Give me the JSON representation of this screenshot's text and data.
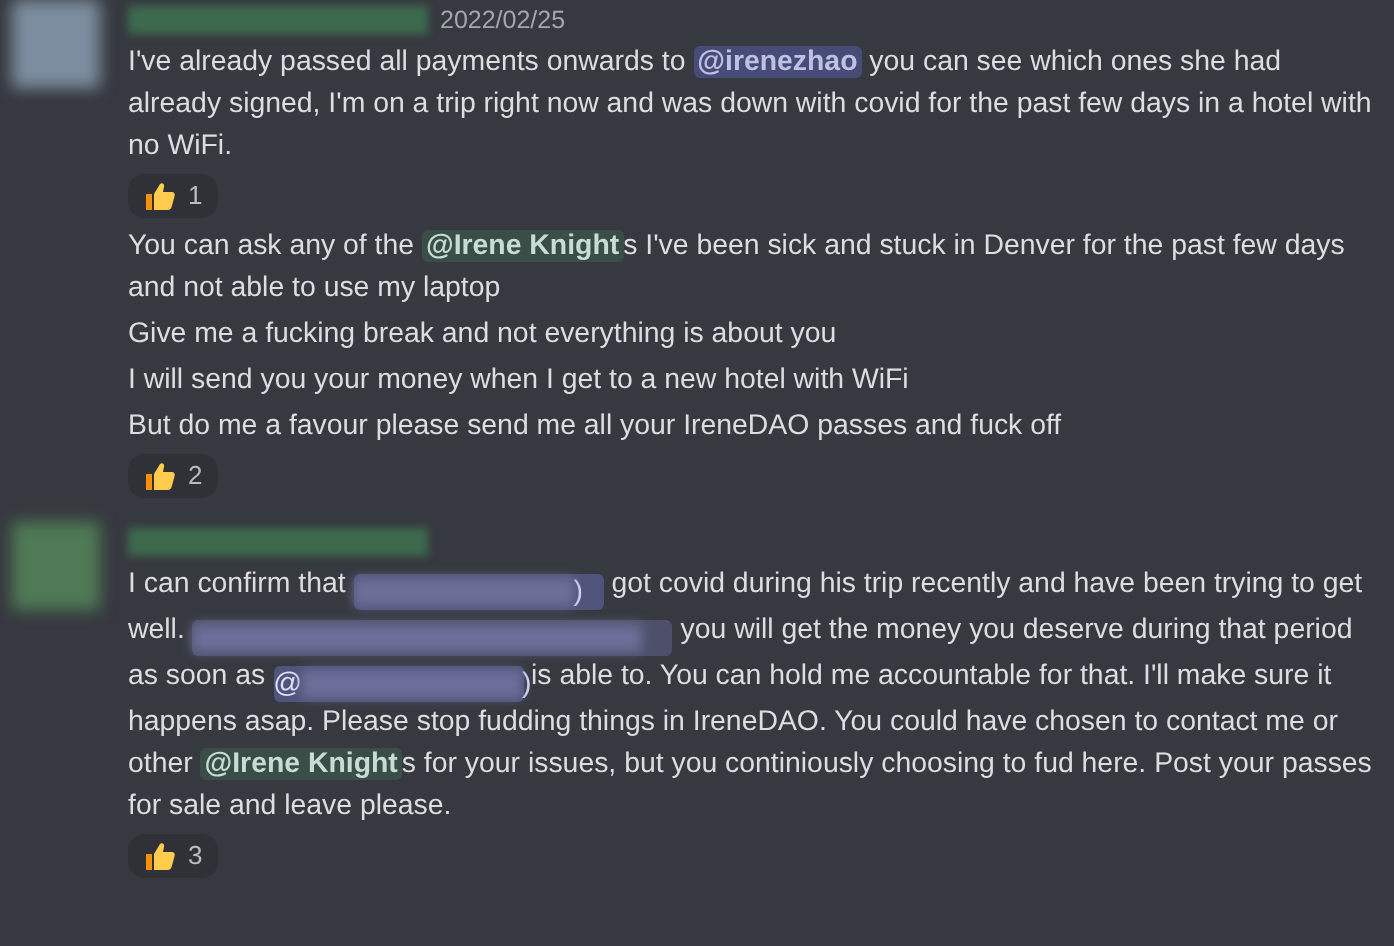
{
  "messages": [
    {
      "avatar": {
        "color": "#7d8ea0"
      },
      "author_redacted": true,
      "timestamp": "2022/02/25",
      "paragraphs": [
        {
          "segments": [
            {
              "kind": "text",
              "text": "I've already passed all payments onwards to "
            },
            {
              "kind": "mention",
              "color": "#474b78",
              "text": "@irenezhao"
            },
            {
              "kind": "text",
              "text": " you can see which ones she had already signed, I'm on a trip right now and was down with covid for the past few days in a hotel with no WiFi."
            }
          ],
          "reaction": {
            "count": "1"
          }
        },
        {
          "segments": [
            {
              "kind": "text",
              "text": "You can ask any of the "
            },
            {
              "kind": "mention",
              "color": "#3a4e47",
              "text": "@Irene Knight"
            },
            {
              "kind": "text",
              "text": "s I've been sick and stuck in Denver for the past few days and not able to use my laptop"
            }
          ]
        },
        {
          "segments": [
            {
              "kind": "text",
              "text": "Give me a fucking break and not everything is about you"
            }
          ]
        },
        {
          "segments": [
            {
              "kind": "text",
              "text": "I will send you your money when I get to a new hotel with WiFi"
            }
          ]
        },
        {
          "segments": [
            {
              "kind": "text",
              "text": "But do me a favour please send me all your IreneDAO passes and fuck off"
            }
          ],
          "reaction": {
            "count": "2"
          }
        }
      ]
    },
    {
      "avatar": {
        "color": "#4f7a55"
      },
      "author_redacted": true,
      "paragraphs": [
        {
          "segments": [
            {
              "kind": "text",
              "text": "I can confirm that "
            },
            {
              "kind": "redacted_mention",
              "suffix": ")"
            },
            {
              "kind": "text",
              "text": " got covid during his trip recently and have been trying to get well. "
            },
            {
              "kind": "redacted_text"
            },
            {
              "kind": "text",
              "text": " you will get the money you deserve during that period as soon as "
            },
            {
              "kind": "redacted_mention",
              "prefix": "@",
              "suffix": ")"
            },
            {
              "kind": "text",
              "text": " is able to. You can hold me accountable for that. I'll make sure it happens asap. Please stop fudding things in IreneDAO. You could have chosen to contact me or other "
            },
            {
              "kind": "mention",
              "color": "#3a4e47",
              "text": "@Irene Knight"
            },
            {
              "kind": "text",
              "text": "s for your issues, but you continiously choosing to fud here. Post your passes for sale and leave please."
            }
          ],
          "reaction": {
            "count": "3"
          }
        }
      ]
    }
  ]
}
